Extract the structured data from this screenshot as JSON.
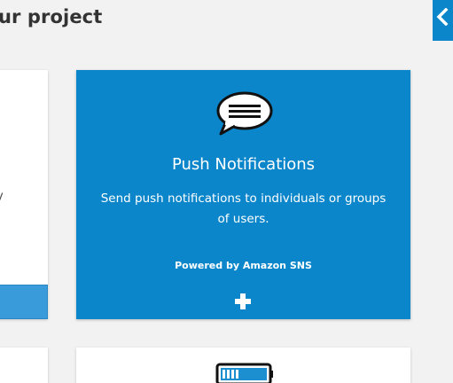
{
  "header": {
    "title": "ur project"
  },
  "sidebar_toggle": {
    "icon": "chevron-left-icon"
  },
  "cards": {
    "left_partial": {
      "text_fragment": "y"
    },
    "push": {
      "icon": "chat-bubble-icon",
      "title": "Push Notifications",
      "description": "Send push notifications to individuals or groups of users.",
      "powered_by": "Powered by Amazon SNS",
      "add_icon": "plus-icon",
      "background": "#0b86cb"
    },
    "bottom_right": {
      "icon": "battery-icon"
    }
  },
  "colors": {
    "accent": "#0b86cb",
    "page_bg": "#f2f2f2"
  }
}
